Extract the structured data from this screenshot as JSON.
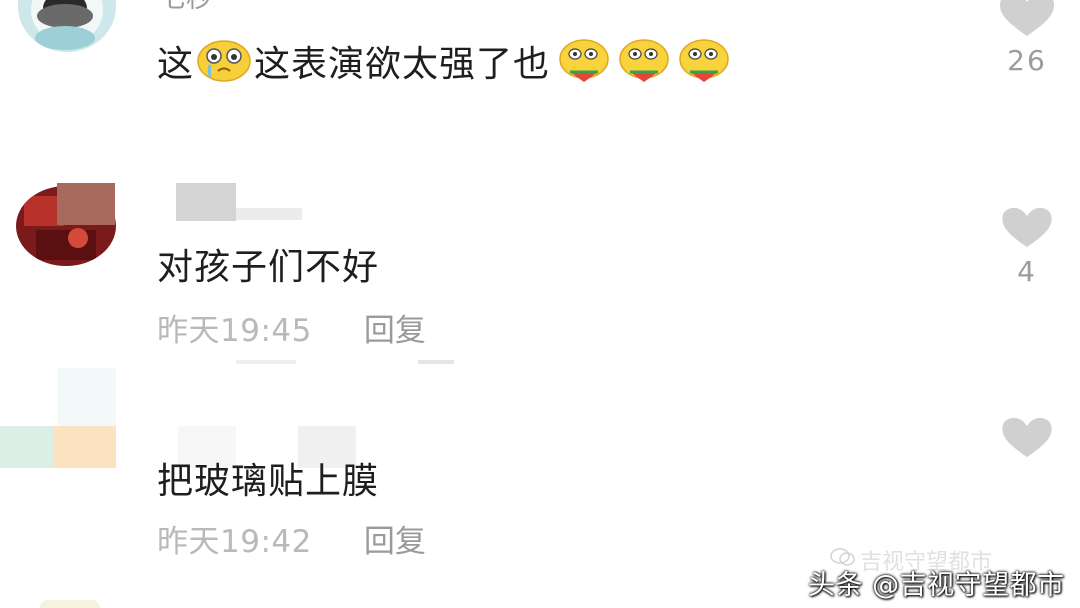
{
  "comments": [
    {
      "username": "七秒",
      "text_parts": [
        "这",
        "这表演欲太强了也"
      ],
      "likes": "26",
      "emoji_names": [
        "teary-face-emoji",
        "watermelon-eating-emoji",
        "watermelon-eating-emoji",
        "watermelon-eating-emoji"
      ]
    },
    {
      "username": "",
      "text": "对孩子们不好",
      "time": "昨天19:45",
      "reply_label": "回复",
      "likes": "4"
    },
    {
      "username": "",
      "text": "把玻璃贴上膜",
      "time": "昨天19:42",
      "reply_label": "回复",
      "likes": ""
    }
  ],
  "watermark": {
    "faint": "吉视守望都市",
    "main": "头条 @吉视守望都市"
  },
  "icons": {
    "like": "heart-icon",
    "wechat": "wechat-logo-icon"
  },
  "colors": {
    "heart": "#d0d0d0",
    "meta_text": "#b9b9b9",
    "comment_text": "#1e1e1e"
  }
}
